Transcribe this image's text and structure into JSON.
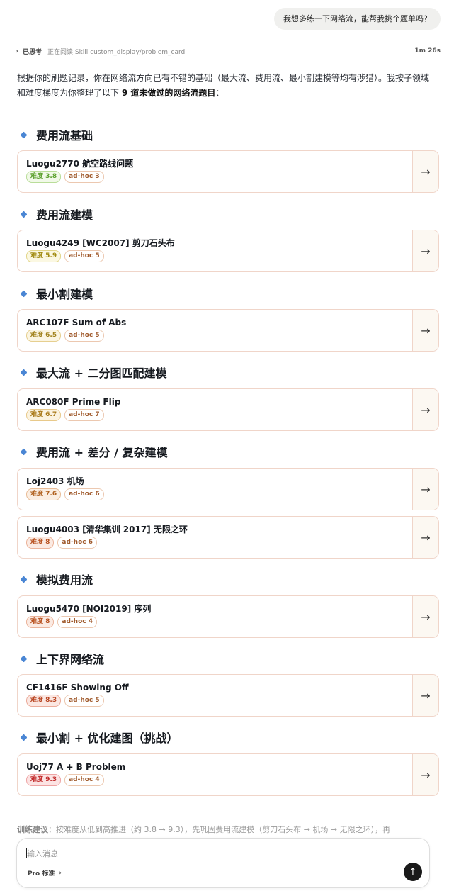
{
  "user_message": "我想多练一下网络流，能帮我挑个题单吗？",
  "thinking": {
    "chevron": "›",
    "status": "已思考",
    "activity": "正在阅读 Skill custom_display/problem_card",
    "duration": "1m 26s"
  },
  "intro": {
    "part1": "根据你的刷题记录，你在网络流方向已有不错的基础（最大流、费用流、最小割建模等均有涉猎）。我按子领域和难度梯度为你整理了以下 ",
    "count": "9 道未做过的网络流题目",
    "part2": "："
  },
  "sections": [
    {
      "title": "费用流基础",
      "cards": [
        {
          "title": "Luogu2770 航空路线问题",
          "difficulty": "难度 3.8",
          "tag": "ad-hoc 3",
          "color": "#5aa02c",
          "bg": "#f1f9e8",
          "border": "#b9dd99"
        }
      ]
    },
    {
      "title": "费用流建模",
      "cards": [
        {
          "title": "Luogu4249 [WC2007] 剪刀石头布",
          "difficulty": "难度 5.9",
          "tag": "ad-hoc 5",
          "color": "#a08a10",
          "bg": "#fbf8e2",
          "border": "#e2d68a"
        }
      ]
    },
    {
      "title": "最小割建模",
      "cards": [
        {
          "title": "ARC107F Sum of Abs",
          "difficulty": "难度 6.5",
          "tag": "ad-hoc 5",
          "color": "#a0801a",
          "bg": "#fbf5e2",
          "border": "#e6cf8f"
        }
      ]
    },
    {
      "title": "最大流 + 二分图匹配建模",
      "cards": [
        {
          "title": "ARC080F Prime Flip",
          "difficulty": "难度 6.7",
          "tag": "ad-hoc 7",
          "color": "#a87818",
          "bg": "#fbf3e0",
          "border": "#e8c98a"
        }
      ]
    },
    {
      "title": "费用流 + 差分 / 复杂建模",
      "cards": [
        {
          "title": "Loj2403 机场",
          "difficulty": "难度 7.6",
          "tag": "ad-hoc 6",
          "color": "#b0601e",
          "bg": "#fbeee2",
          "border": "#e9bd98"
        },
        {
          "title": "Luogu4003 [清华集训 2017] 无限之环",
          "difficulty": "难度 8",
          "tag": "ad-hoc 6",
          "color": "#b8501e",
          "bg": "#fbeae2",
          "border": "#ebb39a"
        }
      ]
    },
    {
      "title": "模拟费用流",
      "cards": [
        {
          "title": "Luogu5470 [NOI2019] 序列",
          "difficulty": "难度 8",
          "tag": "ad-hoc 4",
          "color": "#b8501e",
          "bg": "#fbeae2",
          "border": "#ebb39a"
        }
      ]
    },
    {
      "title": "上下界网络流",
      "cards": [
        {
          "title": "CF1416F Showing Off",
          "difficulty": "难度 8.3",
          "tag": "ad-hoc 5",
          "color": "#b84420",
          "bg": "#fbe7e2",
          "border": "#ebab9a"
        }
      ]
    },
    {
      "title": "最小割 + 优化建图（挑战）",
      "cards": [
        {
          "title": "Uoj77 A + B Problem",
          "difficulty": "难度 9.3",
          "tag": "ad-hoc 4",
          "color": "#c02828",
          "bg": "#fce3e3",
          "border": "#eea3a3"
        }
      ]
    }
  ],
  "arrow": "→",
  "advice": {
    "label": "训练建议",
    "text": "：按难度从低到高推进（约 3.8 → 9.3），先巩固费用流建模（剪刀石头布 → 机场 → 无限之环），再"
  },
  "composer": {
    "placeholder": "输入消息",
    "model": "Pro 标准",
    "model_chevron": "›",
    "send": "↑"
  }
}
